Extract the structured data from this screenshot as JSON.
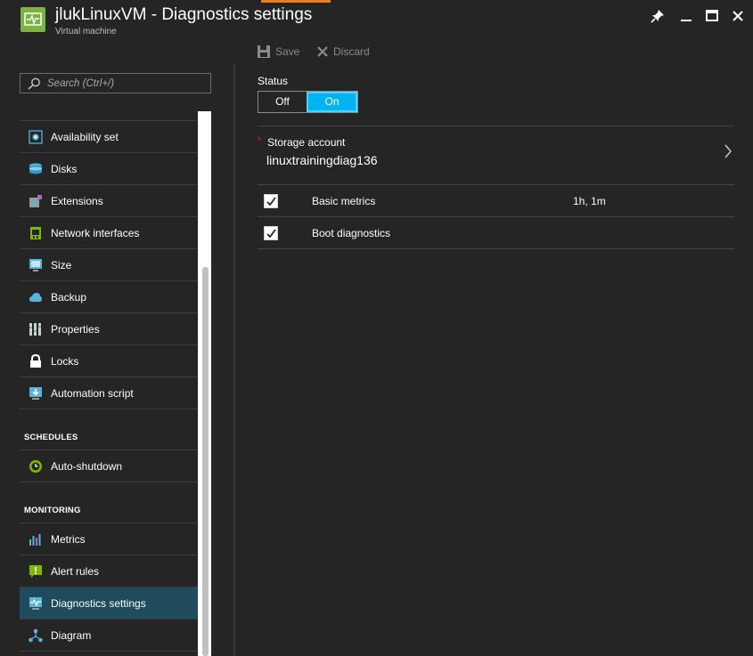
{
  "header": {
    "title": "jlukLinuxVM - Diagnostics settings",
    "subtitle": "Virtual machine",
    "app_icon": "vm-monitor-icon",
    "window_controls": [
      "pin-icon",
      "minimize-icon",
      "maximize-icon",
      "close-icon"
    ],
    "accent_color": "#e67e22"
  },
  "toolbar": {
    "save_label": "Save",
    "discard_label": "Discard"
  },
  "search": {
    "placeholder": "Search (Ctrl+/)"
  },
  "sidebar": {
    "items": [
      {
        "label": "Availability set",
        "icon": "availability-set-icon"
      },
      {
        "label": "Disks",
        "icon": "disks-icon"
      },
      {
        "label": "Extensions",
        "icon": "extensions-icon"
      },
      {
        "label": "Network interfaces",
        "icon": "network-interfaces-icon"
      },
      {
        "label": "Size",
        "icon": "size-icon"
      },
      {
        "label": "Backup",
        "icon": "backup-icon"
      },
      {
        "label": "Properties",
        "icon": "properties-icon"
      },
      {
        "label": "Locks",
        "icon": "lock-icon"
      },
      {
        "label": "Automation script",
        "icon": "automation-script-icon"
      }
    ],
    "schedules": {
      "heading": "SCHEDULES",
      "items": [
        {
          "label": "Auto-shutdown",
          "icon": "clock-icon"
        }
      ]
    },
    "monitoring": {
      "heading": "MONITORING",
      "items": [
        {
          "label": "Metrics",
          "icon": "metrics-icon"
        },
        {
          "label": "Alert rules",
          "icon": "alert-icon"
        },
        {
          "label": "Diagnostics settings",
          "icon": "diagnostics-icon",
          "active": true
        },
        {
          "label": "Diagram",
          "icon": "diagram-icon"
        }
      ]
    }
  },
  "main": {
    "status_label": "Status",
    "toggle": {
      "off_label": "Off",
      "on_label": "On",
      "selected": "On"
    },
    "storage": {
      "required_mark": "*",
      "label": "Storage account",
      "value": "linuxtrainingdiag136"
    },
    "rows": [
      {
        "label": "Basic metrics",
        "checked": true,
        "retention": "1h, 1m"
      },
      {
        "label": "Boot diagnostics",
        "checked": true,
        "retention": ""
      }
    ]
  },
  "colors": {
    "background": "#252525",
    "toggle_on": "#00b4f0",
    "active_nav": "#1f4b5c",
    "required": "#e81123"
  }
}
